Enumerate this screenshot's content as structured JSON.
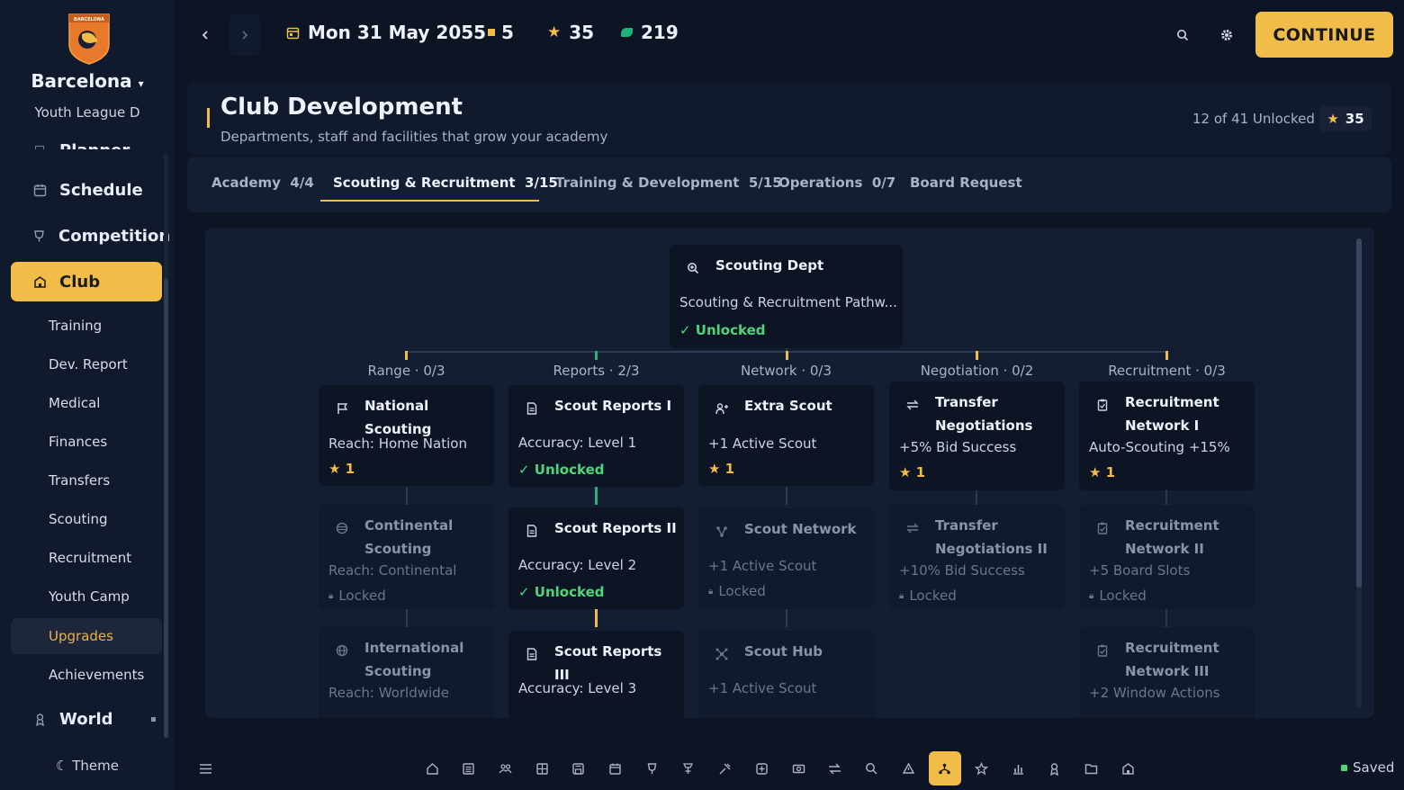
{
  "colors": {
    "accent": "#f2bc49",
    "unlocked": "#4fd67b",
    "currency": "#1fb37a",
    "background": "#0d1424",
    "panel": "#111a2d"
  },
  "sidebar": {
    "logo_text": "BARCELONA",
    "club_name": "Barcelona",
    "club_caret": "▾",
    "league": "Youth League D",
    "partial_item": "Planner",
    "main_items": [
      {
        "label": "Schedule",
        "icon": "calendar-icon"
      },
      {
        "label": "Competition",
        "icon": "trophy-icon"
      },
      {
        "label": "Club",
        "icon": "club-icon"
      }
    ],
    "sub_items": [
      "Training",
      "Dev. Report",
      "Medical",
      "Finances",
      "Transfers",
      "Scouting",
      "Recruitment",
      "Youth Camp",
      "Upgrades",
      "Achievements"
    ],
    "world": {
      "label": "World",
      "icon": "world-icon"
    },
    "theme": {
      "icon": "☾",
      "label": "Theme"
    }
  },
  "topbar": {
    "date": "Mon 31 May 2055",
    "stat_square": "5",
    "stat_star": "35",
    "stat_currency": "219",
    "continue_label": "CONTINUE"
  },
  "header": {
    "title": "Club Development",
    "subtitle": "Departments, staff and facilities that grow your academy",
    "unlocked": "12 of 41 Unlocked",
    "stars": "35"
  },
  "tabs": [
    {
      "label": "Academy",
      "count": "4/4"
    },
    {
      "label": "Scouting & Recruitment",
      "count": "3/15"
    },
    {
      "label": "Training & Development",
      "count": "5/15"
    },
    {
      "label": "Operations",
      "count": "0/7"
    },
    {
      "label": "Board Request",
      "count": ""
    }
  ],
  "tree": {
    "root": {
      "name": "Scouting Dept",
      "desc": "Scouting & Recruitment Pathw...",
      "status": "Unlocked"
    },
    "columns": [
      {
        "label": "Range · 0/3"
      },
      {
        "label": "Reports · 2/3"
      },
      {
        "label": "Network · 0/3"
      },
      {
        "label": "Negotiation · 0/2"
      },
      {
        "label": "Recruitment · 0/3"
      }
    ],
    "nodes": {
      "national": {
        "name": "National Scouting",
        "desc": "Reach: Home Nation",
        "cost": "1"
      },
      "continental": {
        "name": "Continental Scouting",
        "desc": "Reach: Continental",
        "status": "Locked"
      },
      "international": {
        "name": "International Scouting",
        "desc": "Reach: Worldwide"
      },
      "reports1": {
        "name": "Scout Reports I",
        "desc": "Accuracy: Level 1",
        "status": "Unlocked"
      },
      "reports2": {
        "name": "Scout Reports II",
        "desc": "Accuracy: Level 2",
        "status": "Unlocked"
      },
      "reports3": {
        "name": "Scout Reports III",
        "desc": "Accuracy: Level 3"
      },
      "extra_scout": {
        "name": "Extra Scout",
        "desc": "+1 Active Scout",
        "cost": "1"
      },
      "scout_network": {
        "name": "Scout Network",
        "desc": "+1 Active Scout",
        "status": "Locked"
      },
      "scout_hub": {
        "name": "Scout Hub",
        "desc": "+1 Active Scout"
      },
      "transfer1": {
        "name": "Transfer Negotiations",
        "desc": "+5% Bid Success",
        "cost": "1"
      },
      "transfer2": {
        "name": "Transfer Negotiations II",
        "desc": "+10% Bid Success",
        "status": "Locked"
      },
      "recruit1": {
        "name": "Recruitment Network I",
        "desc": "Auto-Scouting +15%",
        "cost": "1"
      },
      "recruit2": {
        "name": "Recruitment Network II",
        "desc": "+5 Board Slots",
        "status": "Locked"
      },
      "recruit3": {
        "name": "Recruitment Network III",
        "desc": "+2 Window Actions"
      }
    }
  },
  "bottombar": {
    "icons": [
      "home-icon",
      "inbox-icon",
      "squad-icon",
      "tactics-icon",
      "save-icon",
      "calendar-icon",
      "trophy-icon",
      "training-icon",
      "medical-icon",
      "plus-icon",
      "finances-icon",
      "transfers-icon",
      "scouting-icon",
      "recruitment-icon",
      "upgrades-icon",
      "achievements-icon",
      "stats-icon",
      "world-icon",
      "folder-icon",
      "club-icon"
    ],
    "saved": "Saved"
  }
}
